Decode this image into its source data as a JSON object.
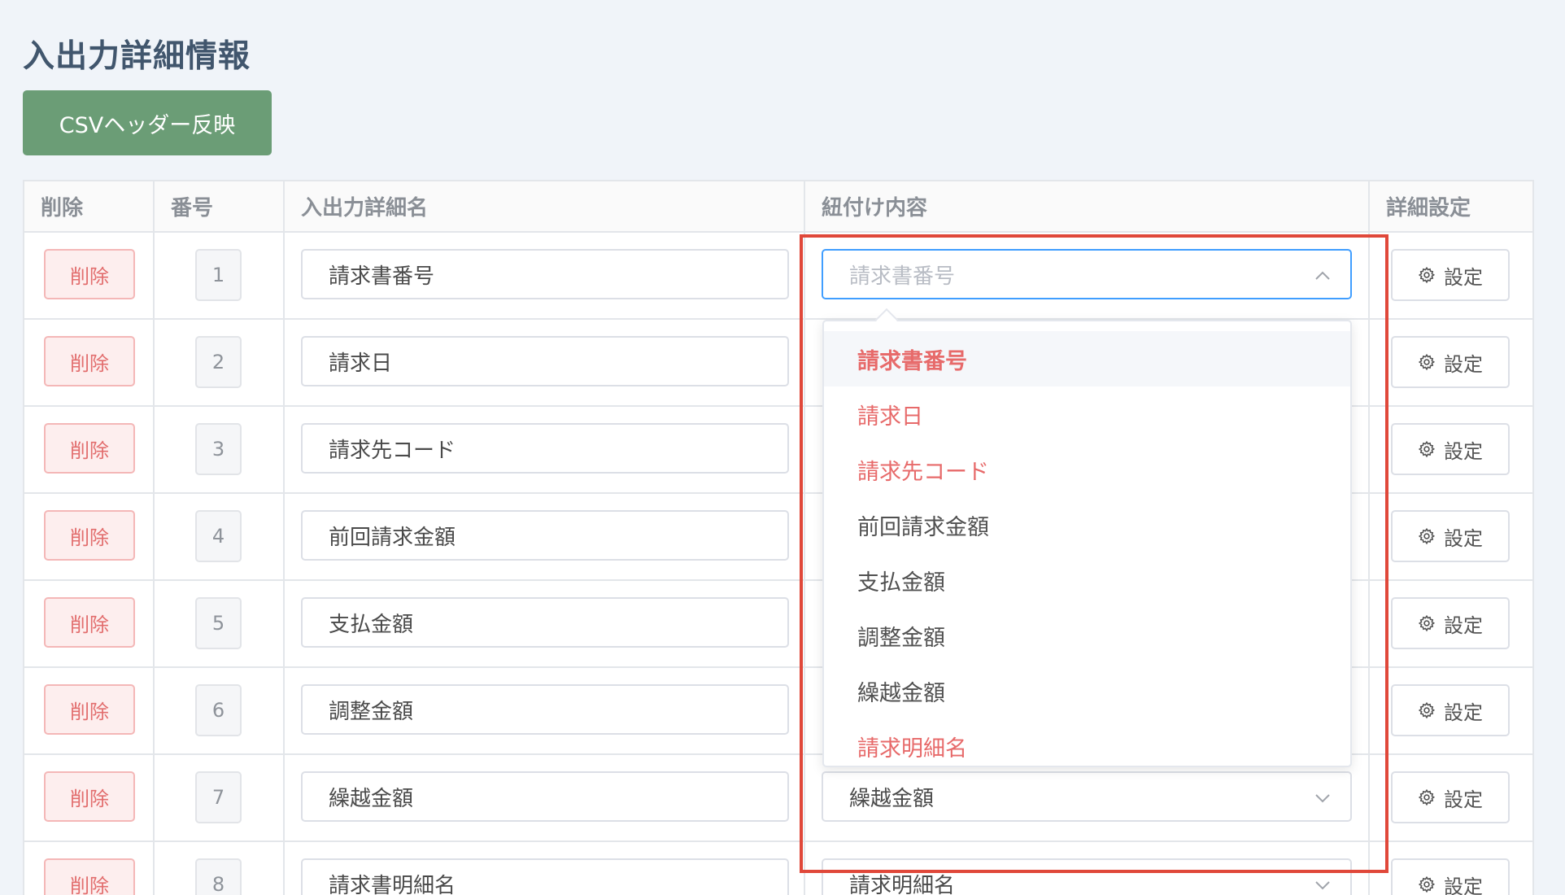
{
  "page": {
    "title": "入出力詳細情報",
    "csv_button_label": "CSVヘッダー反映"
  },
  "table": {
    "headers": {
      "delete": "削除",
      "number": "番号",
      "name": "入出力詳細名",
      "link": "紐付け内容",
      "detail": "詳細設定"
    },
    "delete_label": "削除",
    "settings_label": "設定",
    "rows": [
      {
        "number": "1",
        "name": "請求書番号",
        "link": "請求書番号"
      },
      {
        "number": "2",
        "name": "請求日",
        "link": ""
      },
      {
        "number": "3",
        "name": "請求先コード",
        "link": ""
      },
      {
        "number": "4",
        "name": "前回請求金額",
        "link": ""
      },
      {
        "number": "5",
        "name": "支払金額",
        "link": ""
      },
      {
        "number": "6",
        "name": "調整金額",
        "link": ""
      },
      {
        "number": "7",
        "name": "繰越金額",
        "link": "繰越金額"
      },
      {
        "number": "8",
        "name": "請求書明細名",
        "link": "請求明細名"
      }
    ]
  },
  "dropdown": {
    "open_for_row": "1",
    "placeholder": "請求書番号",
    "options": [
      {
        "label": "請求書番号",
        "mapped": true,
        "selected": true
      },
      {
        "label": "請求日",
        "mapped": true,
        "selected": false
      },
      {
        "label": "請求先コード",
        "mapped": true,
        "selected": false
      },
      {
        "label": "前回請求金額",
        "mapped": false,
        "selected": false
      },
      {
        "label": "支払金額",
        "mapped": false,
        "selected": false
      },
      {
        "label": "調整金額",
        "mapped": false,
        "selected": false
      },
      {
        "label": "繰越金額",
        "mapped": false,
        "selected": false
      },
      {
        "label": "請求明細名",
        "mapped": true,
        "selected": false
      }
    ]
  },
  "colors": {
    "primary_button": "#6b9d76",
    "delete_text": "#e26d6d",
    "mapped_option": "#e76a6a",
    "highlight_border": "#e0483a",
    "focus_border": "#409eff"
  },
  "icons": {
    "settings": "gear-icon",
    "select_open": "chevron-up-icon",
    "select_closed": "chevron-down-icon"
  }
}
